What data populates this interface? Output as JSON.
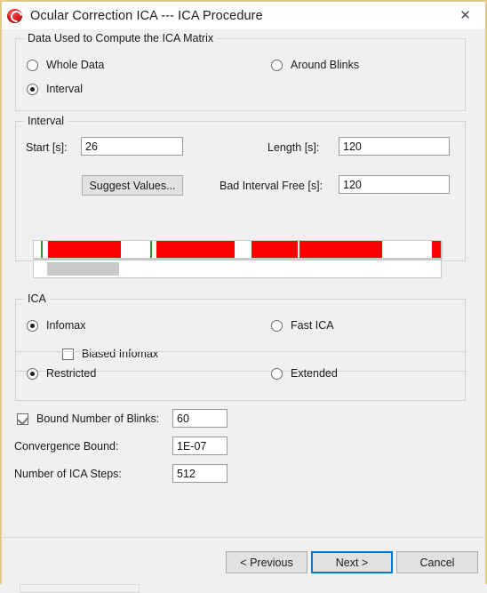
{
  "window": {
    "title": "Ocular Correction ICA --- ICA Procedure",
    "icon": "ocular-ica-icon",
    "close_label": "✕"
  },
  "data_group": {
    "title": "Data Used to Compute the ICA Matrix",
    "options": [
      {
        "label": "Whole Data",
        "selected": false
      },
      {
        "label": "Around Blinks",
        "selected": false
      },
      {
        "label": "Interval",
        "selected": true
      }
    ]
  },
  "interval_group": {
    "title": "Interval",
    "start_label": "Start  [s]:",
    "start_value": "26",
    "length_label": "Length  [s]:",
    "length_value": "120",
    "suggest_button": "Suggest Values...",
    "bad_interval_label": "Bad Interval Free [s]:",
    "bad_interval_value": "120"
  },
  "ica_group": {
    "title": "ICA",
    "infomax_label": "Infomax",
    "infomax_selected": true,
    "fast_ica_label": "Fast ICA",
    "fast_ica_selected": false,
    "biased_infomax_label": "Biased Infomax",
    "biased_infomax_checked": false
  },
  "mode_group": {
    "restricted_label": "Restricted",
    "restricted_selected": true,
    "extended_label": "Extended",
    "extended_selected": false
  },
  "settings": {
    "bound_blinks_label": "Bound Number of Blinks:",
    "bound_blinks_checked": true,
    "bound_blinks_value": "60",
    "convergence_label": "Convergence Bound:",
    "convergence_value": "1E-07",
    "ica_steps_label": "Number of  ICA Steps:",
    "ica_steps_value": "512"
  },
  "footer": {
    "previous_label": "< Previous",
    "next_label": "Next >",
    "cancel_label": "Cancel"
  },
  "colors": {
    "bad_segment": "#fa0202",
    "marker": "#2a9a2a",
    "selection": "#c9c9c9",
    "focus": "#0078d7",
    "window_border": "#e3c98a"
  }
}
